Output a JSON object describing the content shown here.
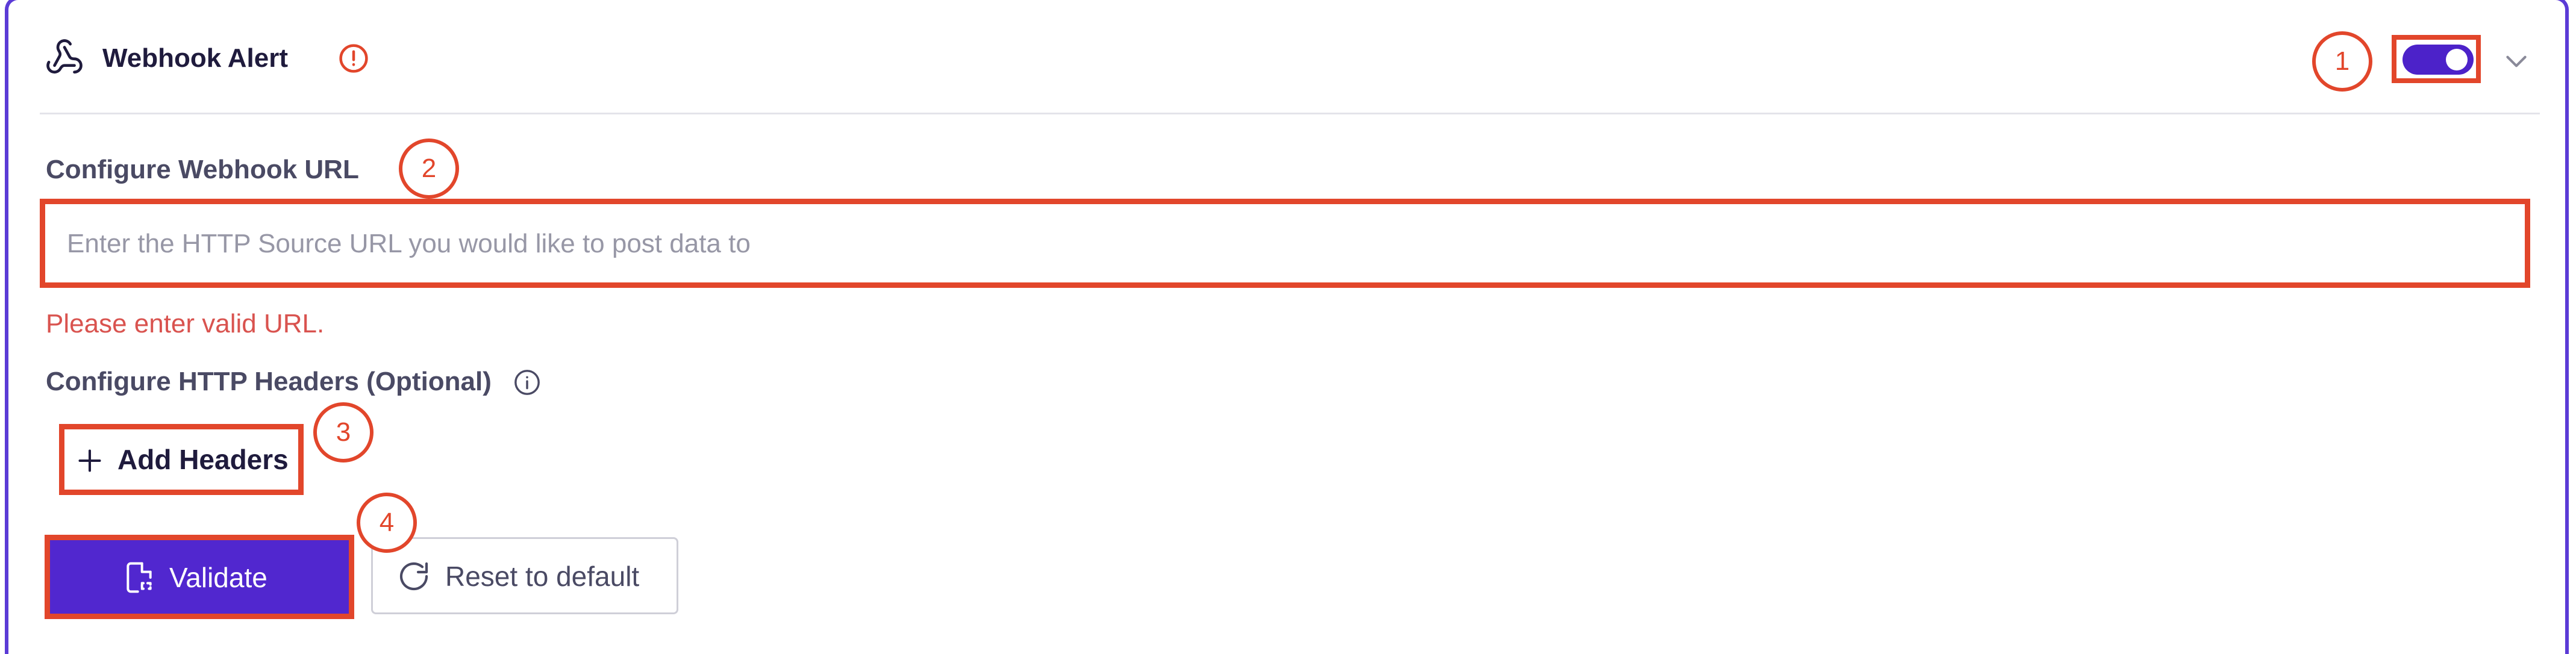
{
  "header": {
    "title": "Webhook Alert",
    "toggle_on": true
  },
  "webhook_url": {
    "label": "Configure Webhook URL",
    "placeholder": "Enter the HTTP Source URL you would like to post data to",
    "value": "",
    "error": "Please enter valid URL."
  },
  "http_headers": {
    "label": "Configure HTTP Headers (Optional)",
    "add_label": "Add Headers"
  },
  "actions": {
    "validate_label": "Validate",
    "reset_label": "Reset to default"
  },
  "callouts": [
    "1",
    "2",
    "3",
    "4"
  ],
  "colors": {
    "accent": "#5127cf",
    "highlight": "#e2462b",
    "error": "#d9534f"
  }
}
